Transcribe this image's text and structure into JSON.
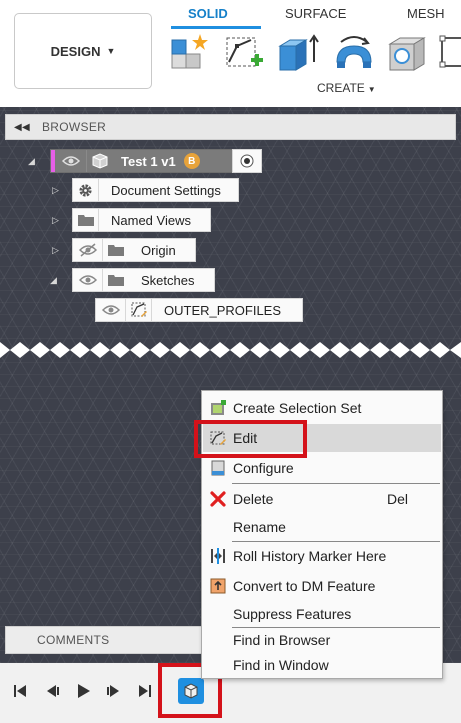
{
  "toolbar": {
    "design_label": "DESIGN",
    "tabs": {
      "solid": "SOLID",
      "surface": "SURFACE",
      "mesh": "MESH"
    },
    "create_label": "CREATE"
  },
  "browser": {
    "header": "BROWSER",
    "root": {
      "label": "Test 1 v1",
      "badge": "B"
    },
    "items": {
      "document_settings": "Document Settings",
      "named_views": "Named Views",
      "origin": "Origin",
      "sketches": "Sketches",
      "outer_profiles": "OUTER_PROFILES"
    }
  },
  "comments_label": "COMMENTS",
  "context_menu": {
    "create_selection_set": "Create Selection Set",
    "edit": "Edit",
    "configure": "Configure",
    "delete": "Delete",
    "delete_shortcut": "Del",
    "rename": "Rename",
    "roll_history": "Roll History Marker Here",
    "convert_dm": "Convert to DM Feature",
    "suppress": "Suppress Features",
    "find_browser": "Find in Browser",
    "find_window": "Find in Window"
  },
  "colors": {
    "accent_blue": "#1f8fe0",
    "highlight_red": "#d4121a",
    "delete_red": "#e02020",
    "canvas": "#3d404b"
  }
}
